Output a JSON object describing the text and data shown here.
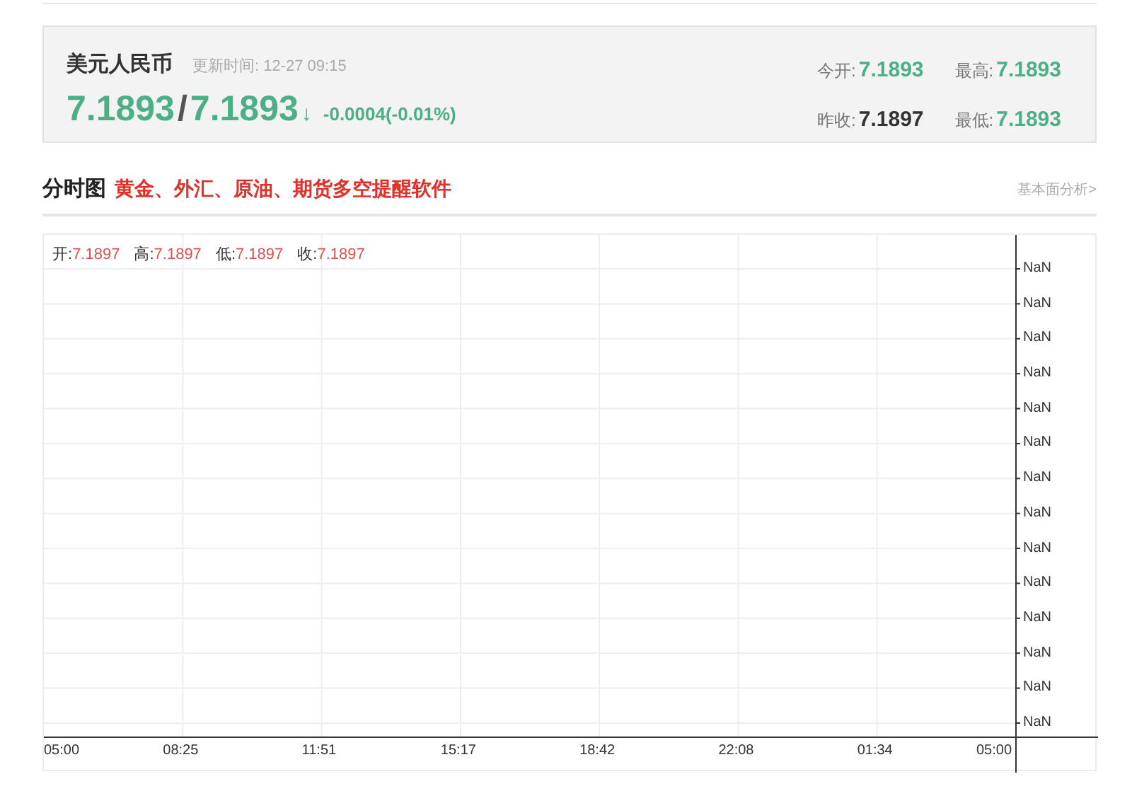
{
  "quote": {
    "name": "美元人民币",
    "update_label": "更新时间:",
    "update_time": "12-27 09:15",
    "color": "#4caf85",
    "bid": "7.1893",
    "separator": "/",
    "ask": "7.1893",
    "arrow": "↓",
    "change": "-0.0004(-0.01%)",
    "stats": [
      {
        "label": "今开:",
        "value": "7.1893",
        "color": "#4caf85"
      },
      {
        "label": "最高:",
        "value": "7.1893",
        "color": "#4caf85"
      },
      {
        "label": "昨收:",
        "value": "7.1897",
        "color": "#333333"
      },
      {
        "label": "最低:",
        "value": "7.1893",
        "color": "#4caf85"
      }
    ]
  },
  "section": {
    "title": "分时图",
    "promo_link": "黄金、外汇、原油、期货多空提醒软件",
    "more_link": "基本面分析>"
  },
  "chart": {
    "ohlc": [
      {
        "label": "开:",
        "value": "7.1897"
      },
      {
        "label": "高:",
        "value": "7.1897"
      },
      {
        "label": "低:",
        "value": "7.1897"
      },
      {
        "label": "收:",
        "value": "7.1897"
      }
    ],
    "y_labels": [
      "NaN",
      "NaN",
      "NaN",
      "NaN",
      "NaN",
      "NaN",
      "NaN",
      "NaN",
      "NaN",
      "NaN",
      "NaN",
      "NaN",
      "NaN",
      "NaN"
    ],
    "x_labels": [
      "05:00",
      "08:25",
      "11:51",
      "15:17",
      "18:42",
      "22:08",
      "01:34",
      "05:00"
    ]
  }
}
